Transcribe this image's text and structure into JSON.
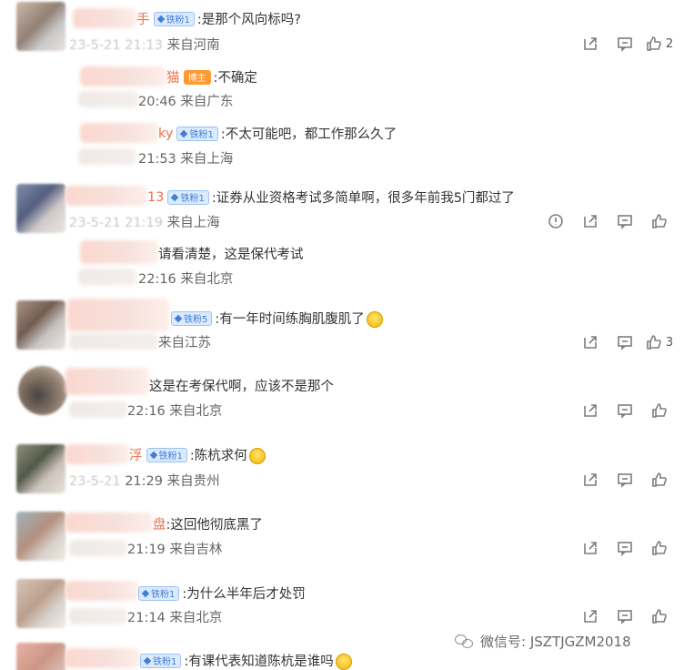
{
  "comments": [
    {
      "nick_tail": "手",
      "badge": "铁粉1",
      "text": ":是那个风向标吗?",
      "meta_prefix": "23-5-21 2",
      "meta_time_faded": "1:13",
      "location": "来自河南",
      "likes": "2",
      "has_report": false
    },
    {
      "nick_tail": "猫",
      "badge": "博主",
      "text": ":不确定",
      "meta_prefix": "",
      "meta_time_faded": "",
      "time": "20:46",
      "location": "来自广东",
      "reply": true
    },
    {
      "nick_tail": "ky",
      "badge": "铁粉1",
      "text": ":不太可能吧，都工作那么久了",
      "meta_prefix": "",
      "time": "21:53",
      "location": "来自上海",
      "reply": true
    },
    {
      "nick_tail": "13",
      "badge": "铁粉1",
      "text": ":证券从业资格考试多简单啊，很多年前我5门都过了",
      "meta_prefix": "23-5-21 ",
      "time": "21:19",
      "location": "来自上海",
      "likes": "",
      "has_report": true
    },
    {
      "nick_tail": "",
      "badge": "",
      "text": "请看清楚，这是保代考试",
      "time": "22:16",
      "location": "来自北京",
      "reply": true
    },
    {
      "nick_tail": "",
      "badge": "铁粉5",
      "text": ":有一年时间练胸肌腹肌了",
      "time": "",
      "location": "来自江苏",
      "likes": "3",
      "emoji": true
    },
    {
      "nick_tail": "",
      "badge": "",
      "text": "这是在考保代啊，应该不是那个",
      "time": "22:16",
      "location": "来自北京"
    },
    {
      "nick_tail": "浮",
      "badge": "铁粉1",
      "text": ":陈杭求何",
      "meta_prefix": "23-5-21 ",
      "time": "21:29",
      "location": "来自贵州",
      "emoji": true
    },
    {
      "nick_tail": "盘",
      "badge": "",
      "text": ":这回他彻底黑了",
      "time": "21:19",
      "location": "来自吉林"
    },
    {
      "nick_tail": "",
      "badge": "铁粉1",
      "text": ":为什么半年后才处罚",
      "time": "21:14",
      "location": "来自北京"
    },
    {
      "nick_tail": "",
      "badge": "铁粉1",
      "text": ":有课代表知道陈杭是谁吗",
      "emoji": true
    }
  ],
  "icons": {
    "share": "share-icon",
    "comment": "comment-icon",
    "like": "like-icon",
    "report": "report-icon"
  },
  "watermark": {
    "label": "微信号: JSZTJGZM2018"
  },
  "colors": {
    "nick": "#eb7350",
    "badge_blue": "#3f7fd6",
    "badge_host": "#ff9a32",
    "meta": "#666666"
  }
}
